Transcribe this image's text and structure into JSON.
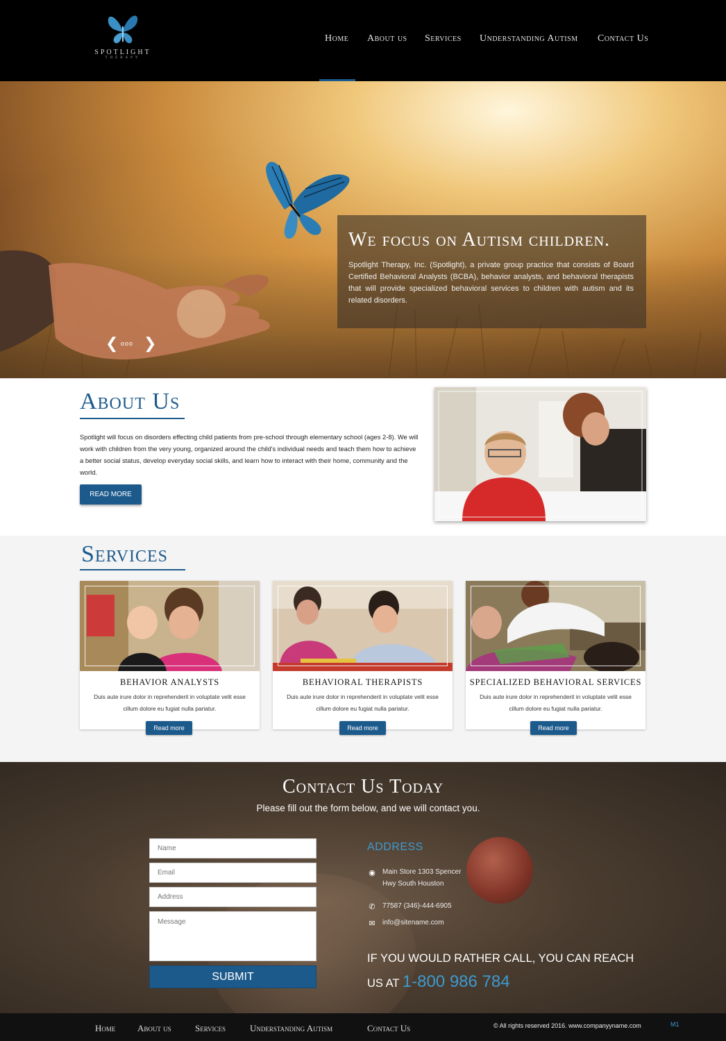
{
  "header": {
    "logo_name": "Spotlight",
    "logo_sub": "Therapy",
    "nav": [
      {
        "label": "Home",
        "active": true
      },
      {
        "label": "About us",
        "active": false
      },
      {
        "label": "Services",
        "active": false
      },
      {
        "label": "Understanding Autism",
        "active": false
      },
      {
        "label": "Contact Us",
        "active": false
      }
    ]
  },
  "hero": {
    "headline": "We focus on Autism children.",
    "body": "Spotlight Therapy, Inc. (Spotlight), a private group practice that consists of Board Certified Behavioral Analysts (BCBA), behavior analysts, and behavioral therapists that will provide specialized behavioral services to children with autism and its related disorders.",
    "prev_icon": "chevron-left-icon",
    "next_icon": "chevron-right-icon",
    "dots": "ooo"
  },
  "about": {
    "title": "About Us",
    "text": "Spotlight will focus on disorders effecting child patients from pre-school through elementary school (ages 2-8). We will work with children from the very young, organized around the child's individual needs and teach them how to achieve a better social status, develop everyday social skills, and learn how to interact with their home, community and the world.",
    "button": "READ MORE"
  },
  "services": {
    "title": "Services",
    "cards": [
      {
        "title": "BEHAVIOR ANALYSTS",
        "text": "Duis aute irure dolor in reprehenderit in voluptate velit esse cillum dolore eu fugiat nulla pariatur.",
        "button": "Read more"
      },
      {
        "title": "BEHAVIORAL THERAPISTS",
        "text": "Duis aute irure dolor in reprehenderit in voluptate velit esse cillum dolore eu fugiat nulla pariatur.",
        "button": "Read more"
      },
      {
        "title": "SPECIALIZED BEHAVIORAL SERVICES",
        "text": "Duis aute irure dolor in reprehenderit in voluptate velit esse cillum dolore eu fugiat nulla pariatur.",
        "button": "Read more"
      }
    ]
  },
  "contact": {
    "title": "Contact Us Today",
    "subtitle": "Please fill out the form below, and we will contact you.",
    "form": {
      "name_placeholder": "Name",
      "email_placeholder": "Email",
      "address_placeholder": "Address",
      "message_placeholder": "Message",
      "submit": "SUBMIT"
    },
    "address_title": "ADDRESS",
    "address_line1": "Main Store 1303 Spencer",
    "address_line2": "Hwy South Houston",
    "phone": "77587 (346)-444-6905",
    "email": "info@sitename.com",
    "call_line1": "IF YOU WOULD RATHER CALL, YOU CAN REACH",
    "call_line2": "US AT",
    "call_number": "1-800 986 784",
    "icons": {
      "location": "map-pin-icon",
      "phone": "phone-icon",
      "email": "envelope-icon"
    }
  },
  "footer": {
    "nav": [
      "Home",
      "About us",
      "Services",
      "Understanding Autism",
      "Contact Us"
    ],
    "copyright": "© All rights reserved 2016. www.companyyname.com",
    "mark": "M1"
  },
  "colors": {
    "brand_blue": "#1d5a8c",
    "accent_blue": "#3e9ad0",
    "header_bg": "#000000",
    "services_bg": "#f4f4f4"
  }
}
